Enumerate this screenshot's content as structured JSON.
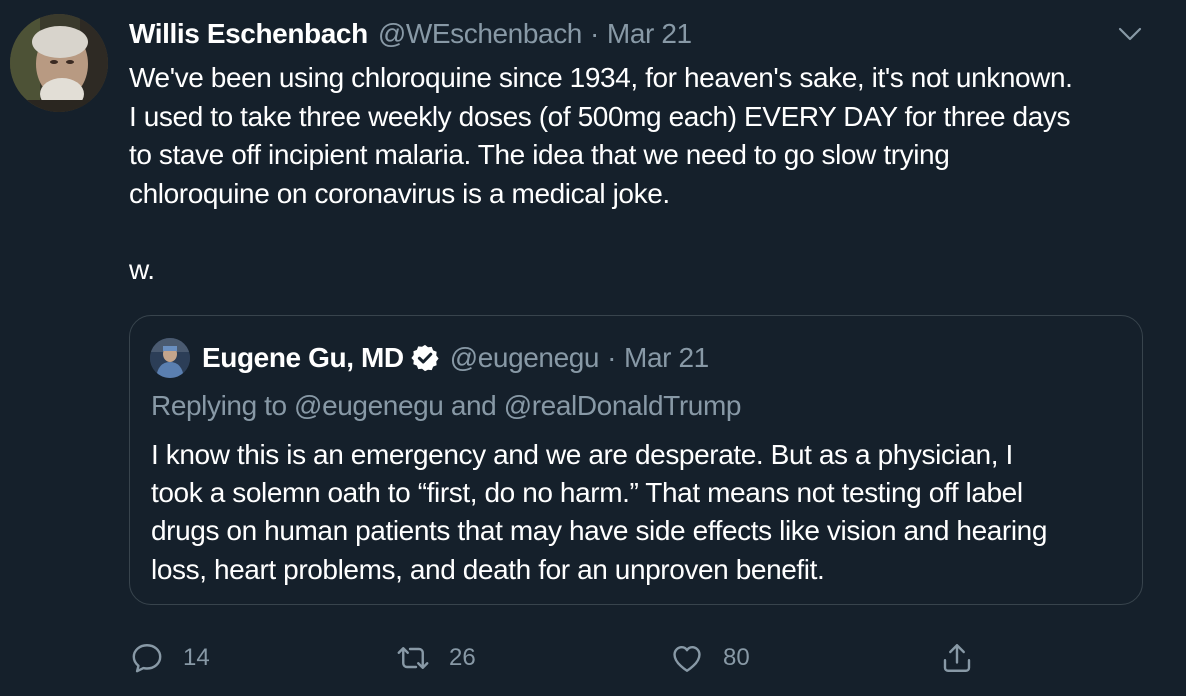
{
  "tweet": {
    "author_name": "Willis Eschenbach",
    "author_handle": "@WEschenbach",
    "separator": "·",
    "date": "Mar 21",
    "body_lines": [
      "We've been using chloroquine since 1934, for heaven's sake, it's not unknown.",
      "I used to take three weekly doses (of 500mg each) EVERY DAY for three days",
      "to stave off incipient malaria. The idea that we need to go slow trying",
      "chloroquine on coronavirus is a medical joke."
    ],
    "signature": "w."
  },
  "quoted_tweet": {
    "author_name": "Eugene Gu, MD",
    "author_handle": "@eugenegu",
    "separator": "·",
    "date": "Mar 21",
    "replying_to": "Replying to @eugenegu and @realDonaldTrump",
    "body_lines": [
      "I know this is an emergency and we are desperate. But as a physician, I",
      "took a solemn oath to “first, do no harm.” That means not testing off label",
      "drugs on human patients that may have side effects like vision and hearing",
      "loss, heart problems, and death for an unproven benefit."
    ]
  },
  "actions": {
    "reply_count": "14",
    "retweet_count": "26",
    "like_count": "80"
  },
  "icons": {
    "reply": "reply-icon",
    "retweet": "retweet-icon",
    "like": "heart-icon",
    "share": "share-icon",
    "more": "chevron-down-icon",
    "verified": "verified-badge-icon"
  },
  "colors": {
    "background": "#15202b",
    "text_primary": "#ffffff",
    "text_secondary": "#8899a6",
    "border": "#38444d",
    "verified_badge": "#ffffff"
  }
}
